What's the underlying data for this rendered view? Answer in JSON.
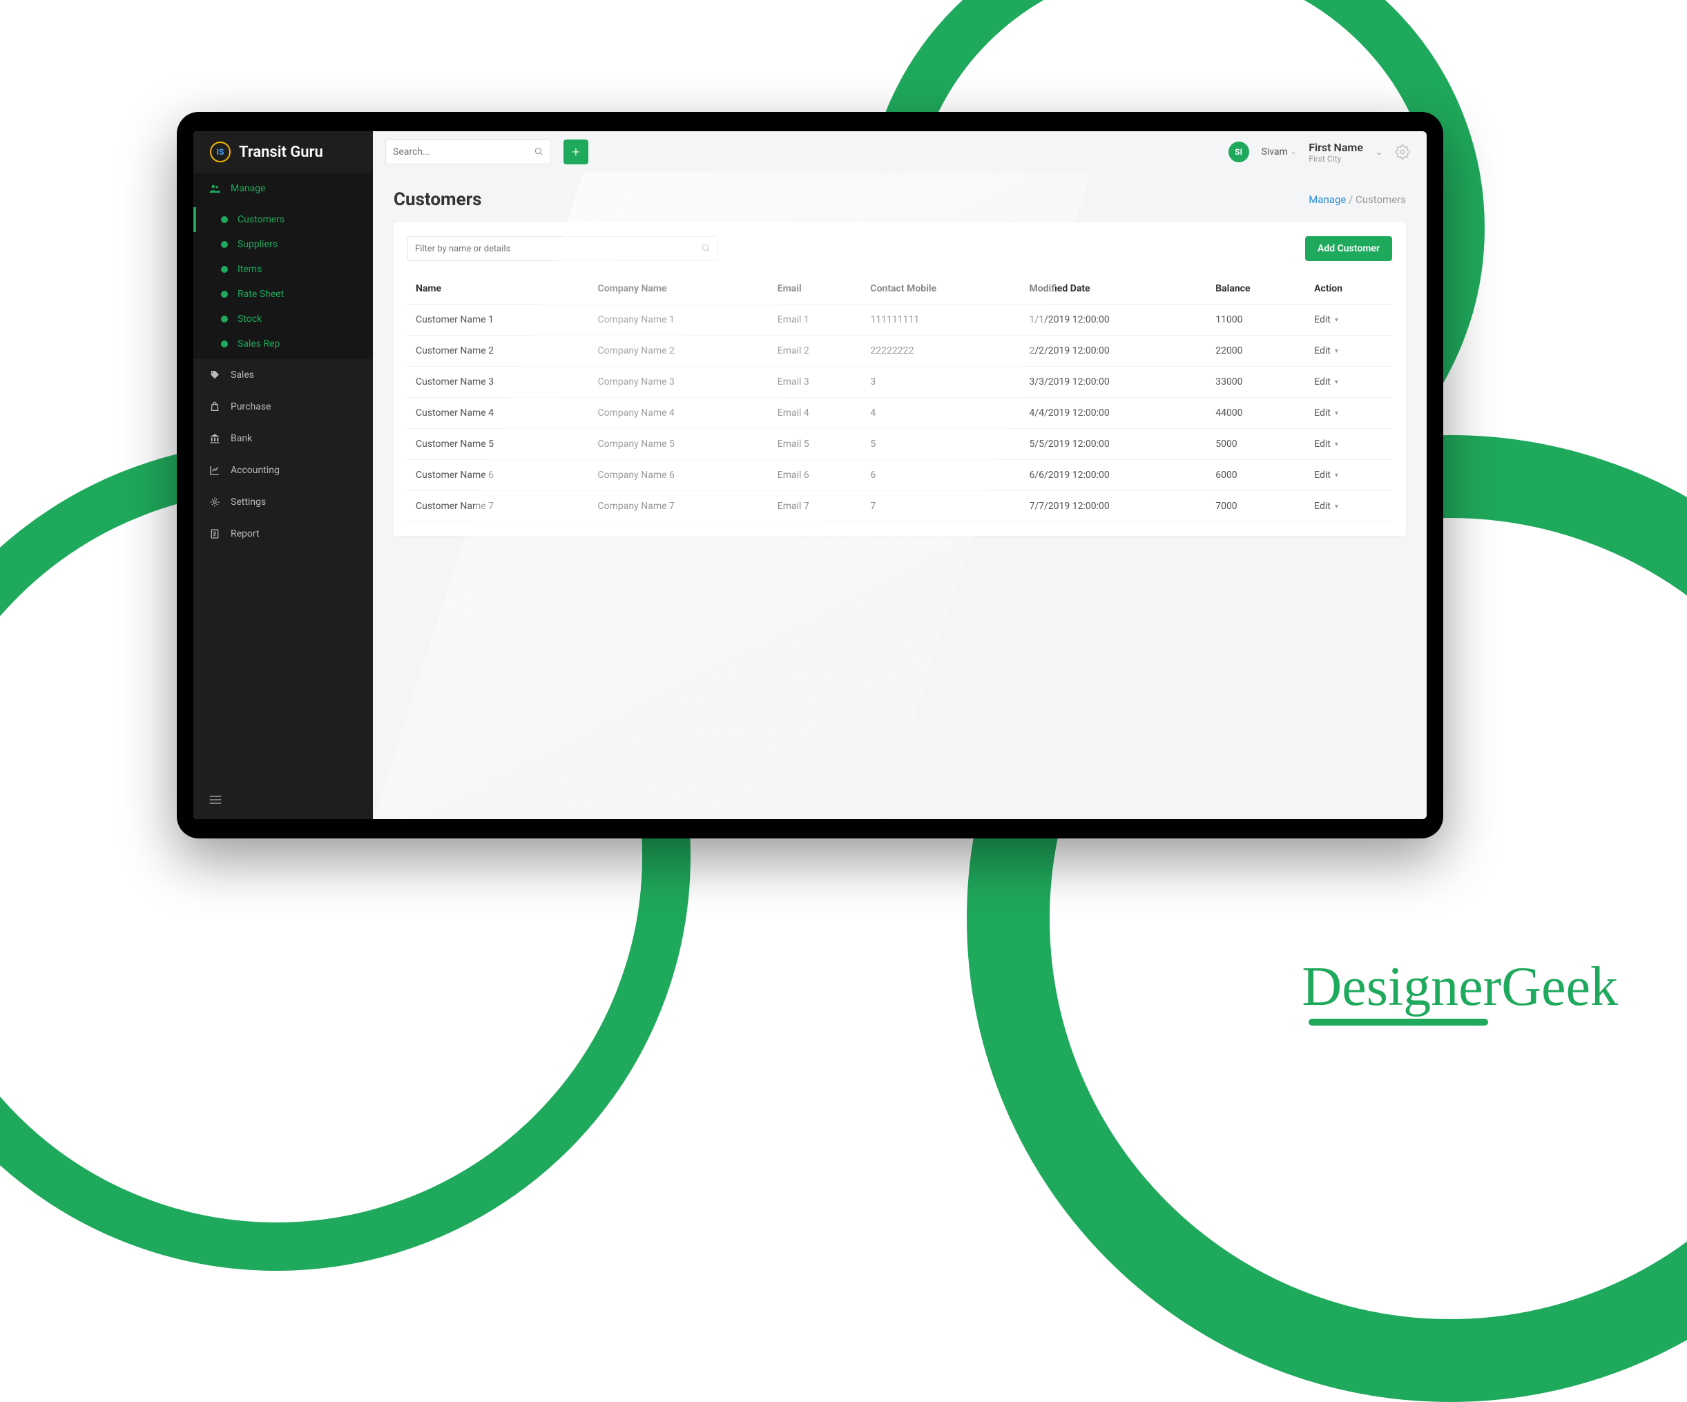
{
  "brand": {
    "name": "Transit Guru",
    "logo_text": "IS"
  },
  "search": {
    "placeholder": "Search..."
  },
  "user": {
    "avatar_initials": "SI",
    "short_name": "Sivam",
    "profile_name": "First Name",
    "profile_sub": "First City"
  },
  "sidebar": {
    "manage_label": "Manage",
    "sub_items": [
      {
        "label": "Customers",
        "current": true
      },
      {
        "label": "Suppliers"
      },
      {
        "label": "Items"
      },
      {
        "label": "Rate Sheet"
      },
      {
        "label": "Stock"
      },
      {
        "label": "Sales Rep"
      }
    ],
    "items": [
      {
        "label": "Sales",
        "icon": "tag"
      },
      {
        "label": "Purchase",
        "icon": "bag"
      },
      {
        "label": "Bank",
        "icon": "bank"
      },
      {
        "label": "Accounting",
        "icon": "chart"
      },
      {
        "label": "Settings",
        "icon": "gear"
      },
      {
        "label": "Report",
        "icon": "report"
      }
    ]
  },
  "page": {
    "title": "Customers",
    "breadcrumb_root": "Manage",
    "breadcrumb_sep": " / ",
    "breadcrumb_leaf": "Customers"
  },
  "filter": {
    "placeholder": "Filter by name or details"
  },
  "add_button": "Add Customer",
  "columns": [
    "Name",
    "Company Name",
    "Email",
    "Contact Mobile",
    "Modified Date",
    "Balance",
    "Action"
  ],
  "action_label": "Edit",
  "rows": [
    {
      "name": "Customer Name 1",
      "company": "Company Name 1",
      "email": "Email 1",
      "mobile": "111111111",
      "modified": "1/1/2019 12:00:00",
      "balance": "11000"
    },
    {
      "name": "Customer Name 2",
      "company": "Company Name 2",
      "email": "Email 2",
      "mobile": "22222222",
      "modified": "2/2/2019 12:00:00",
      "balance": "22000"
    },
    {
      "name": "Customer Name 3",
      "company": "Company Name 3",
      "email": "Email 3",
      "mobile": "3",
      "modified": "3/3/2019 12:00:00",
      "balance": "33000"
    },
    {
      "name": "Customer Name 4",
      "company": "Company Name 4",
      "email": "Email 4",
      "mobile": "4",
      "modified": "4/4/2019 12:00:00",
      "balance": "44000"
    },
    {
      "name": "Customer Name 5",
      "company": "Company Name 5",
      "email": "Email 5",
      "mobile": "5",
      "modified": "5/5/2019 12:00:00",
      "balance": "5000"
    },
    {
      "name": "Customer Name 6",
      "company": "Company Name 6",
      "email": "Email 6",
      "mobile": "6",
      "modified": "6/6/2019 12:00:00",
      "balance": "6000"
    },
    {
      "name": "Customer Name 7",
      "company": "Company Name 7",
      "email": "Email 7",
      "mobile": "7",
      "modified": "7/7/2019 12:00:00",
      "balance": "7000"
    }
  ]
}
